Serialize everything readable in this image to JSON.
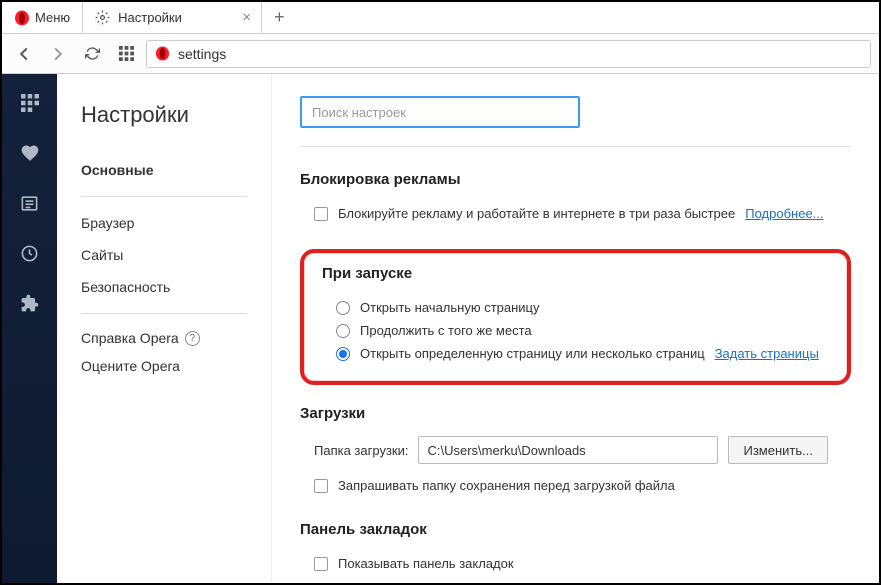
{
  "titlebar": {
    "menu_label": "Меню",
    "tab_title": "Настройки"
  },
  "toolbar": {
    "address": "settings"
  },
  "sidebar_nav": {
    "title": "Настройки",
    "items": [
      "Основные",
      "Браузер",
      "Сайты",
      "Безопасность"
    ],
    "help": "Справка Opera",
    "rate": "Оцените Opera"
  },
  "main": {
    "search_placeholder": "Поиск настроек",
    "ad_block": {
      "title": "Блокировка рекламы",
      "checkbox_label": "Блокируйте рекламу и работайте в интернете в три раза быстрее",
      "learn_more": "Подробнее..."
    },
    "startup": {
      "title": "При запуске",
      "opt1": "Открыть начальную страницу",
      "opt2": "Продолжить с того же места",
      "opt3": "Открыть определенную страницу или несколько страниц",
      "set_pages": "Задать страницы"
    },
    "downloads": {
      "title": "Загрузки",
      "folder_label": "Папка загрузки:",
      "folder_value": "C:\\Users\\merku\\Downloads",
      "change_btn": "Изменить...",
      "ask_checkbox": "Запрашивать папку сохранения перед загрузкой файла"
    },
    "bookmarks": {
      "title": "Панель закладок",
      "show_checkbox": "Показывать панель закладок"
    }
  }
}
